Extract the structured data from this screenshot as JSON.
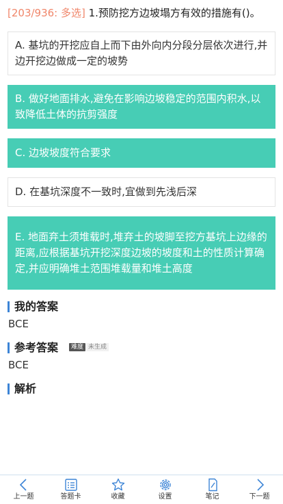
{
  "question": {
    "meta": "[203/936: 多选]",
    "text": " 1.预防挖方边坡塌方有效的措施有()。"
  },
  "options": {
    "a": {
      "text": "A. 基坑的开挖应自上而下由外向内分段分层依次进行,并边开挖边做成一定的坡势",
      "selected": false
    },
    "b": {
      "text": "B. 做好地面排水,避免在影响边坡稳定的范围内积水,以致降低土体的抗剪强度",
      "selected": true
    },
    "c": {
      "text": "C. 边坡坡度符合要求",
      "selected": true
    },
    "d": {
      "text": "D. 在基坑深度不一致时,宜做到先浅后深",
      "selected": false
    },
    "e": {
      "text": "E. 地面弃土须堆载时,堆弃土的坡脚至挖方基坑上边缘的距离,应根据基坑开挖深度边坡的坡度和土的性质计算确定,并应明确堆土范围堆载量和堆土高度",
      "selected": true
    }
  },
  "my_answer": {
    "title": "我的答案",
    "value": "BCE"
  },
  "reference_answer": {
    "title": "参考答案",
    "badge_difficulty": "难度",
    "badge_status": "未生成",
    "value": "BCE"
  },
  "analysis": {
    "title": "解析"
  },
  "colors": {
    "selected": "#47cdb5",
    "accent": "#3c84d6",
    "meta": "#f0866a"
  },
  "bottom_nav": {
    "prev": {
      "label": "上一题",
      "icon": "chevron-left-icon"
    },
    "card": {
      "label": "答题卡",
      "icon": "answer-card-icon"
    },
    "favorite": {
      "label": "收藏",
      "icon": "star-icon"
    },
    "settings": {
      "label": "设置",
      "icon": "gear-icon"
    },
    "notes": {
      "label": "笔记",
      "icon": "note-pen-icon"
    },
    "next": {
      "label": "下一题",
      "icon": "chevron-right-icon"
    }
  }
}
